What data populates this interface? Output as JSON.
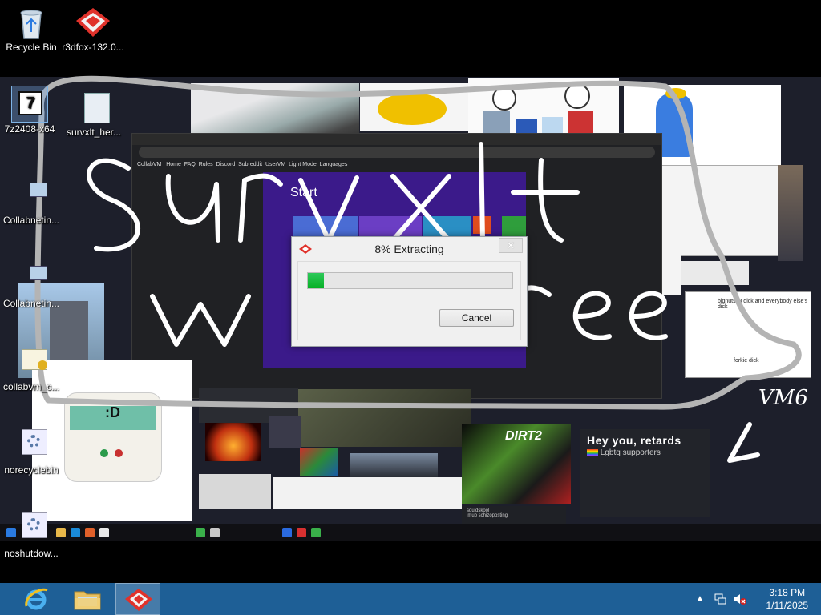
{
  "desktop": {
    "icons": [
      {
        "label": "Recycle Bin",
        "icon": "recycle-bin-icon"
      },
      {
        "label": "r3dfox-132.0...",
        "icon": "r3dfox-icon"
      }
    ]
  },
  "wallpaper": {
    "icons": [
      {
        "label": "7z2408-x64",
        "icon": "7zip-icon"
      },
      {
        "label": "survxlt_her...",
        "icon": "document-icon"
      },
      {
        "label": "Collabnetin...",
        "icon": "network-computer-icon"
      },
      {
        "label": "Collabnetin...",
        "icon": "network-computer-icon"
      },
      {
        "label": "collabvm_c...",
        "icon": "certificate-icon"
      },
      {
        "label": "norecyclebin",
        "icon": "settings-gear-icon"
      },
      {
        "label": "noshutdow...",
        "icon": "settings-gear-icon"
      }
    ],
    "graffiti_text": "survxlt was here",
    "vm_label": "VM6",
    "inner_browser": {
      "menu_items": [
        "CollabVM",
        "Home",
        "FAQ",
        "Rules",
        "Discord",
        "Subreddit",
        "UserVM",
        "Light Mode",
        "Languages"
      ]
    },
    "start_screen_label": "Start",
    "poster_heading": "Hey you, retards",
    "poster_subheading": "Lgbtq supporters",
    "chat_username": "squidskool",
    "chat_message": "lmub schizoposting"
  },
  "dialog": {
    "title": "8% Extracting",
    "progress_percent": 8,
    "cancel_label": "Cancel",
    "close_symbol": "✕",
    "app_icon": "r3dfox-icon"
  },
  "taskbar": {
    "buttons": [
      {
        "name": "internet-explorer",
        "icon": "internet-explorer-icon",
        "active": false
      },
      {
        "name": "file-explorer",
        "icon": "folder-icon",
        "active": false
      },
      {
        "name": "r3dfox",
        "icon": "r3dfox-icon",
        "active": true
      }
    ],
    "tray_icons": [
      "show-hidden-icons-chevron-icon",
      "network-icon",
      "volume-muted-icon"
    ],
    "clock": {
      "time": "3:18 PM",
      "date": "1/11/2025"
    }
  },
  "colors": {
    "taskbar": "#1e5f96",
    "progress_fill": "#06b025",
    "start_screen": "#3b1a8a",
    "r3dfox_red": "#e0322b"
  }
}
